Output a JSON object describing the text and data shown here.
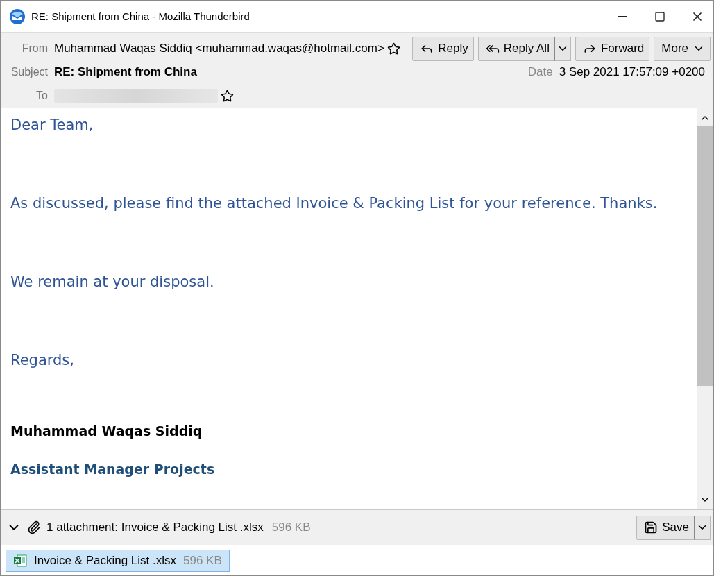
{
  "window": {
    "title": "RE: Shipment from China - Mozilla Thunderbird"
  },
  "header": {
    "from_label": "From",
    "from": "Muhammad Waqas Siddiq <muhammad.waqas@hotmail.com>",
    "subject_label": "Subject",
    "subject": "RE: Shipment from China",
    "date_label": "Date",
    "date": "3 Sep 2021 17:57:09 +0200",
    "to_label": "To"
  },
  "buttons": [
    {
      "kind": "reply",
      "label": "Reply",
      "dropdown": false
    },
    {
      "kind": "reply-all",
      "label": "Reply All",
      "dropdown": true
    },
    {
      "kind": "forward",
      "label": "Forward",
      "dropdown": false
    },
    {
      "kind": "more",
      "label": "More",
      "dropdown": false
    }
  ],
  "body": [
    {
      "kind": "text",
      "text": "Dear Team,"
    },
    {
      "kind": "text",
      "text": "As discussed, please find the attached Invoice & Packing List for your reference. Thanks."
    },
    {
      "kind": "text",
      "text": "We remain at your disposal."
    },
    {
      "kind": "text",
      "text": "Regards,"
    },
    {
      "kind": "name",
      "text": "Muhammad Waqas Siddiq"
    },
    {
      "kind": "role",
      "text": "Assistant Manager Projects"
    }
  ],
  "attachment_bar": {
    "expanded": true,
    "summary": "1 attachment: Invoice & Packing List .xlsx",
    "size": "596 KB",
    "save": "Save"
  },
  "attachments": [
    {
      "name": "Invoice & Packing List .xlsx",
      "size": "596 KB",
      "selected": true
    }
  ]
}
